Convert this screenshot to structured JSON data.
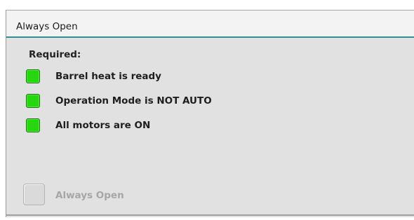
{
  "panel": {
    "title": "Always Open",
    "required_label": "Required:",
    "conditions": [
      {
        "label": "Barrel heat is ready",
        "status": "ok",
        "status_color": "#26d70f"
      },
      {
        "label": "Operation Mode is NOT AUTO",
        "status": "ok",
        "status_color": "#26d70f"
      },
      {
        "label": "All motors are ON",
        "status": "ok",
        "status_color": "#26d70f"
      }
    ],
    "action": {
      "label": "Always Open",
      "enabled": false
    }
  },
  "colors": {
    "accent_underline": "#2e8f97",
    "panel_background": "#e1e1e1",
    "disabled_text": "#a6a6a6"
  }
}
